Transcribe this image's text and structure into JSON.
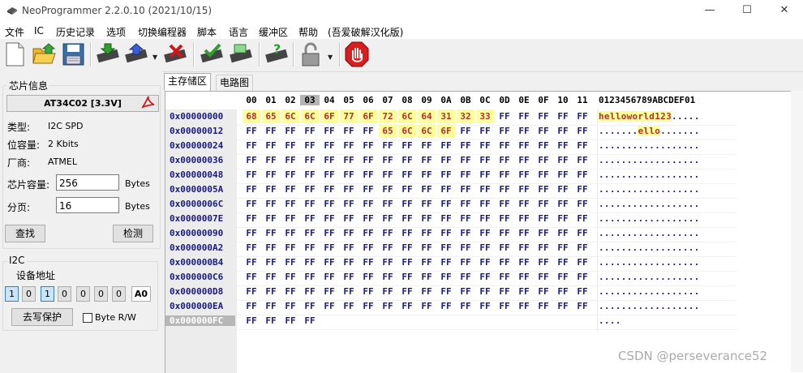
{
  "window": {
    "title": "NeoProgrammer 2.2.0.10 (2021/10/15)",
    "minimize": "—",
    "maximize": "☐",
    "close": "✕"
  },
  "menu": [
    "文件",
    "IC",
    "历史记录",
    "选项",
    "切换编程器",
    "脚本",
    "语言",
    "缓冲区",
    "帮助",
    "(吾爱破解汉化版)"
  ],
  "toolbar_icons": [
    "new-file-icon",
    "open-folder-icon",
    "save-disk-icon",
    "read-chip-icon",
    "write-chip-icon",
    "erase-chip-icon",
    "verify-chip-icon",
    "blank-check-icon",
    "auto-detect-icon",
    "lock-icon",
    "stop-icon"
  ],
  "chip_info": {
    "group_title": "芯片信息",
    "chip_name": "AT34C02 [3.3V]",
    "type_label": "类型:",
    "type_value": "I2C SPD",
    "bits_label": "位容量:",
    "bits_value": "2 Kbits",
    "vendor_label": "厂商:",
    "vendor_value": "ATMEL",
    "size_label": "芯片容量:",
    "size_value": "256",
    "size_unit": "Bytes",
    "page_label": "分页:",
    "page_value": "16",
    "page_unit": "Bytes",
    "search_button": "查找",
    "detect_button": "检测"
  },
  "i2c": {
    "group_title": "I2C",
    "addr_label": "设备地址",
    "bits": [
      "1",
      "0",
      "1",
      "0",
      "0",
      "0",
      "0"
    ],
    "bits_pressed": [
      true,
      false,
      true,
      false,
      false,
      false,
      false
    ],
    "a0_label": "A0",
    "unprotect_button": "去写保护",
    "byte_rw_label": "Byte R/W",
    "byte_rw_checked": false
  },
  "tabs": [
    "主存储区",
    "电路图"
  ],
  "hex": {
    "columns": [
      "00",
      "01",
      "02",
      "03",
      "04",
      "05",
      "06",
      "07",
      "08",
      "09",
      "0A",
      "0B",
      "0C",
      "0D",
      "0E",
      "0F",
      "10",
      "11"
    ],
    "current_column": "03",
    "ascii_header": "0123456789ABCDEF01",
    "addresses": [
      "0x00000000",
      "0x00000012",
      "0x00000024",
      "0x00000036",
      "0x00000048",
      "0x0000005A",
      "0x0000006C",
      "0x0000007E",
      "0x00000090",
      "0x000000A2",
      "0x000000B4",
      "0x000000C6",
      "0x000000D8",
      "0x000000EA",
      "0x000000FC"
    ],
    "selected_address": "0x000000FC",
    "row0": [
      "68",
      "65",
      "6C",
      "6C",
      "6F",
      "77",
      "6F",
      "72",
      "6C",
      "64",
      "31",
      "32",
      "33",
      "FF",
      "FF",
      "FF",
      "FF",
      "FF"
    ],
    "row0_modified_count": 13,
    "row1": [
      "FF",
      "FF",
      "FF",
      "FF",
      "FF",
      "FF",
      "FF",
      "65",
      "6C",
      "6C",
      "6F",
      "FF",
      "FF",
      "FF",
      "FF",
      "FF",
      "FF",
      "FF"
    ],
    "row1_modified_range": [
      7,
      10
    ],
    "fill": "FF",
    "last_row_count": 4,
    "ascii_rows": {
      "row0_highlight": "helloworld123",
      "row0_rest": ".....",
      "row1_prefix": ".......",
      "row1_highlight": "ello",
      "row1_rest": ".......",
      "full_row": "..................",
      "last_row": "...."
    }
  },
  "watermark": "CSDN @perseverance52"
}
